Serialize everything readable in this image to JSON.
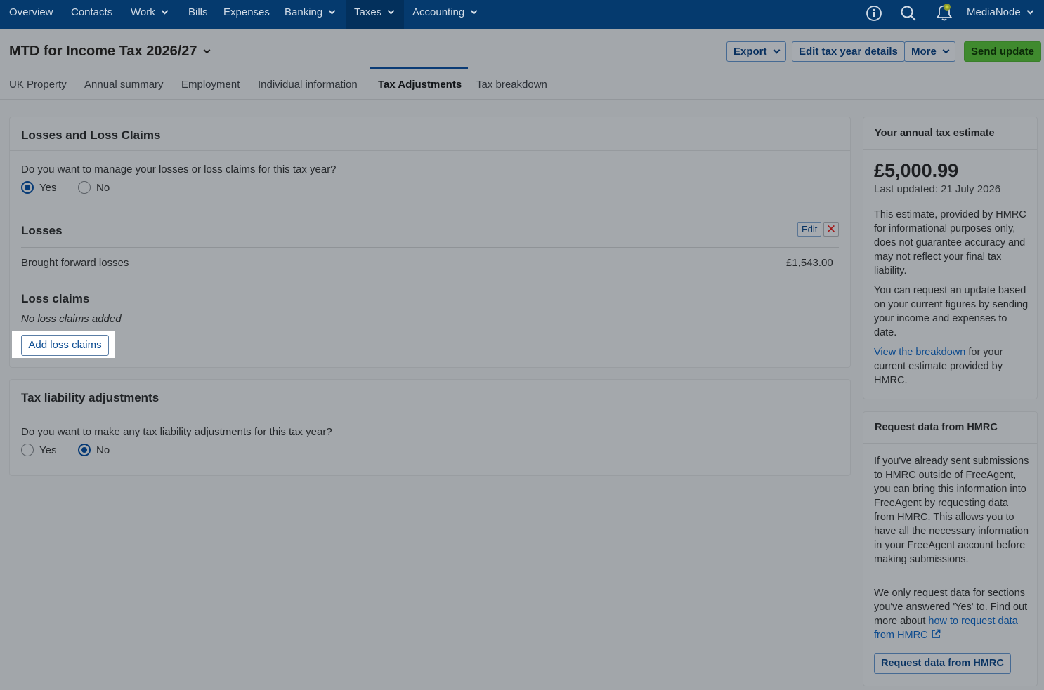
{
  "nav": {
    "items": [
      {
        "label": "Overview"
      },
      {
        "label": "Contacts"
      },
      {
        "label": "Work"
      },
      {
        "label": "Bills"
      },
      {
        "label": "Expenses"
      },
      {
        "label": "Banking"
      },
      {
        "label": "Taxes"
      },
      {
        "label": "Accounting"
      }
    ],
    "account": "MediaNode",
    "icons": [
      "info-icon",
      "search-icon",
      "notification-bell-icon"
    ]
  },
  "header": {
    "title": "MTD for Income Tax 2026/27",
    "export_label": "Export",
    "edit_label": "Edit tax year details",
    "more_label": "More",
    "send_label": "Send update"
  },
  "tabs": [
    {
      "label": "UK Property"
    },
    {
      "label": "Annual summary"
    },
    {
      "label": "Employment"
    },
    {
      "label": "Individual information"
    },
    {
      "label": "Tax Adjustments"
    },
    {
      "label": "Tax breakdown"
    }
  ],
  "losses_panel": {
    "title": "Losses and Loss Claims",
    "question": "Do you want to manage your losses or loss claims for this tax year?",
    "yes": "Yes",
    "no": "No",
    "selected": "Yes",
    "losses_title": "Losses",
    "edit_label": "Edit",
    "brought_forward_label": "Brought forward losses",
    "brought_forward_value": "£1,543.00",
    "claims_title": "Loss claims",
    "claims_empty": "No loss claims added",
    "add_claims_label": "Add loss claims"
  },
  "liability_panel": {
    "title": "Tax liability adjustments",
    "question": "Do you want to make any tax liability adjustments for this tax year?",
    "yes": "Yes",
    "no": "No",
    "selected": "No"
  },
  "estimate_panel": {
    "title": "Your annual tax estimate",
    "amount": "£5,000.99",
    "updated": "Last updated: 21 July 2026",
    "para1": "This estimate, provided by HMRC for informational purposes only, does not guarantee accuracy and may not reflect your final tax liability.",
    "para2": "You can request an update based on your current figures by sending your income and expenses to date.",
    "link": "View the breakdown",
    "para3_rest": " for your current estimate provided by HMRC."
  },
  "hmrc_panel": {
    "title": "Request data from HMRC",
    "para1": "If you've already sent submissions to HMRC outside of FreeAgent, you can bring this information into FreeAgent by requesting data from HMRC. This allows you to have all the necessary information in your FreeAgent account before making submissions.",
    "para2": "We only request data for sections you've answered 'Yes' to. Find out more about ",
    "link": "how to request data from HMRC",
    "button": "Request data from HMRC"
  },
  "colors": {
    "nav_bg": "#053a6e",
    "accent": "#063a76",
    "send_button": "#3f8a2e",
    "delete": "#a01818"
  }
}
